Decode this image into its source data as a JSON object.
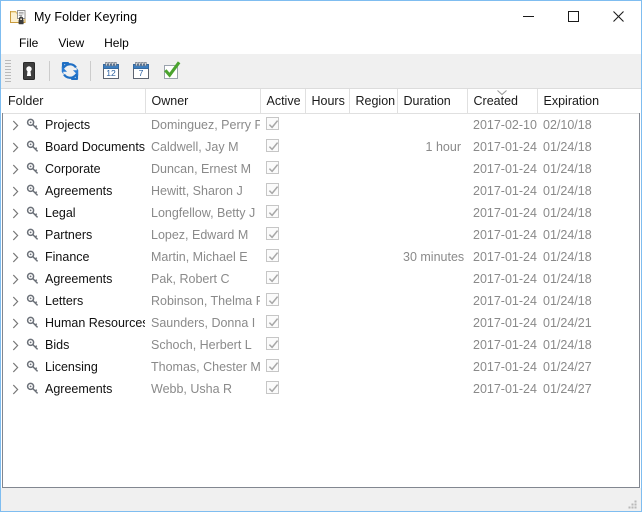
{
  "window": {
    "title": "My Folder Keyring",
    "title_icon": "folder-lock-icon",
    "controls": {
      "minimize": "minimize-icon",
      "maximize": "maximize-icon",
      "close": "close-icon"
    }
  },
  "menu": {
    "items": [
      {
        "label": "File"
      },
      {
        "label": "View"
      },
      {
        "label": "Help"
      }
    ]
  },
  "toolbar": {
    "buttons": [
      {
        "icon": "keyhole-icon",
        "label": "Keyhole"
      },
      {
        "icon": "refresh-icon",
        "label": "Refresh"
      },
      {
        "icon": "calendar-12-icon",
        "label": "12",
        "badge": "12"
      },
      {
        "icon": "calendar-7-icon",
        "label": "7",
        "badge": "7"
      },
      {
        "icon": "green-check-icon",
        "label": "Approve"
      }
    ]
  },
  "list": {
    "columns": [
      {
        "key": "folder",
        "label": "Folder",
        "align": "left"
      },
      {
        "key": "owner",
        "label": "Owner",
        "align": "left"
      },
      {
        "key": "active",
        "label": "Active",
        "align": "left"
      },
      {
        "key": "hours",
        "label": "Hours",
        "align": "left"
      },
      {
        "key": "region",
        "label": "Region",
        "align": "left"
      },
      {
        "key": "duration",
        "label": "Duration",
        "align": "left"
      },
      {
        "key": "created",
        "label": "Created",
        "align": "left",
        "sorted": "desc"
      },
      {
        "key": "expiration",
        "label": "Expiration",
        "align": "left"
      }
    ],
    "rows": [
      {
        "folder": "Projects",
        "owner": "Dominguez, Perry P",
        "active": true,
        "hours": "",
        "region": "",
        "duration": "",
        "created": "2017-02-10",
        "expiration": "02/10/18"
      },
      {
        "folder": "Board Documents",
        "owner": "Caldwell, Jay M",
        "active": true,
        "hours": "",
        "region": "",
        "duration": "1 hour",
        "created": "2017-01-24",
        "expiration": "01/24/18"
      },
      {
        "folder": "Corporate",
        "owner": "Duncan, Ernest M",
        "active": true,
        "hours": "",
        "region": "",
        "duration": "",
        "created": "2017-01-24",
        "expiration": "01/24/18"
      },
      {
        "folder": "Agreements",
        "owner": "Hewitt, Sharon J",
        "active": true,
        "hours": "",
        "region": "",
        "duration": "",
        "created": "2017-01-24",
        "expiration": "01/24/18"
      },
      {
        "folder": "Legal",
        "owner": "Longfellow, Betty J",
        "active": true,
        "hours": "",
        "region": "",
        "duration": "",
        "created": "2017-01-24",
        "expiration": "01/24/18"
      },
      {
        "folder": "Partners",
        "owner": "Lopez, Edward M",
        "active": true,
        "hours": "",
        "region": "",
        "duration": "",
        "created": "2017-01-24",
        "expiration": "01/24/18"
      },
      {
        "folder": "Finance",
        "owner": "Martin, Michael E",
        "active": true,
        "hours": "",
        "region": "",
        "duration": "30 minutes",
        "created": "2017-01-24",
        "expiration": "01/24/18"
      },
      {
        "folder": "Agreements",
        "owner": "Pak, Robert C",
        "active": true,
        "hours": "",
        "region": "",
        "duration": "",
        "created": "2017-01-24",
        "expiration": "01/24/18"
      },
      {
        "folder": "Letters",
        "owner": "Robinson, Thelma R",
        "active": true,
        "hours": "",
        "region": "",
        "duration": "",
        "created": "2017-01-24",
        "expiration": "01/24/18"
      },
      {
        "folder": "Human Resources",
        "owner": "Saunders, Donna I",
        "active": true,
        "hours": "",
        "region": "",
        "duration": "",
        "created": "2017-01-24",
        "expiration": "01/24/21"
      },
      {
        "folder": "Bids",
        "owner": "Schoch, Herbert L",
        "active": true,
        "hours": "",
        "region": "",
        "duration": "",
        "created": "2017-01-24",
        "expiration": "01/24/18"
      },
      {
        "folder": "Licensing",
        "owner": "Thomas, Chester M",
        "active": true,
        "hours": "",
        "region": "",
        "duration": "",
        "created": "2017-01-24",
        "expiration": "01/24/27"
      },
      {
        "folder": "Agreements",
        "owner": "Webb, Usha R",
        "active": true,
        "hours": "",
        "region": "",
        "duration": "",
        "created": "2017-01-24",
        "expiration": "01/24/27"
      }
    ]
  },
  "statusbar": {
    "text": ""
  },
  "colors": {
    "window_border": "#7fbdf0",
    "toolbar_bg": "#f0f0f0",
    "text": "#111111",
    "muted_text": "#8a8a8a",
    "accent_blue": "#2b7cd3",
    "check_green": "#4ba32f"
  }
}
